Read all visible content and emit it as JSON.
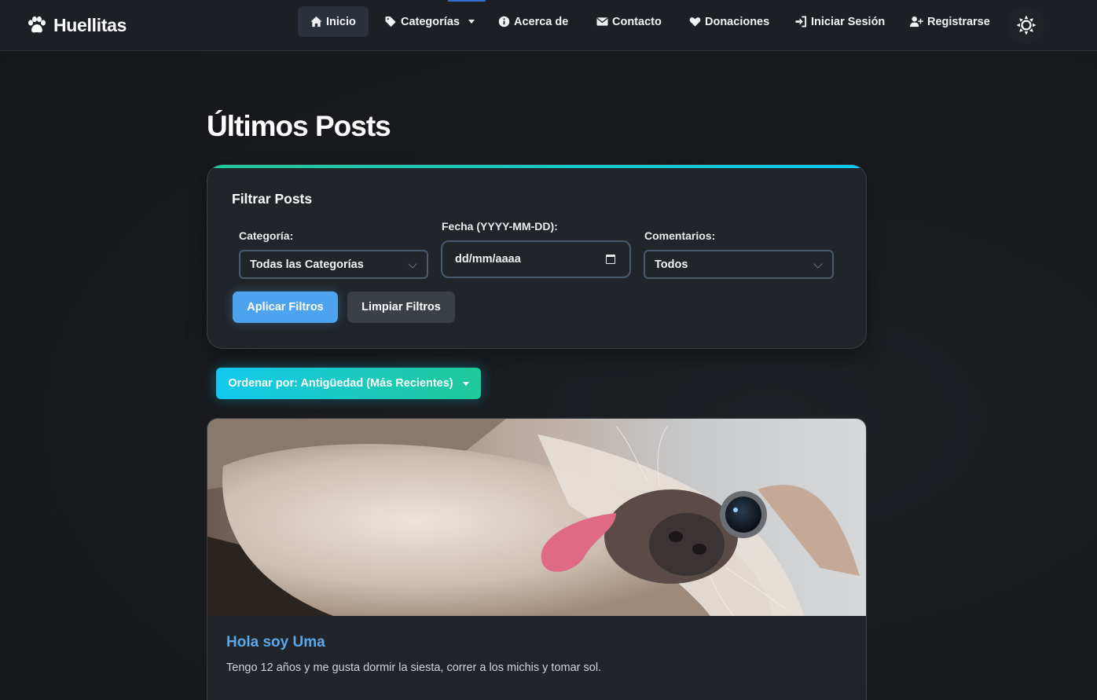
{
  "navbar": {
    "brand": "Huellitas",
    "items": [
      {
        "label": "Inicio",
        "icon": "home-icon"
      },
      {
        "label": "Categorías",
        "icon": "tags-icon"
      },
      {
        "label": "Acerca de",
        "icon": "info-circle-icon"
      },
      {
        "label": "Contacto",
        "icon": "envelope-icon"
      },
      {
        "label": "Donaciones",
        "icon": "heart-icon"
      },
      {
        "label": "Iniciar Sesión",
        "icon": "sign-in-icon"
      },
      {
        "label": "Registrarse",
        "icon": "user-plus-icon"
      }
    ],
    "theme_toggle_icon": "sun-icon"
  },
  "page": {
    "title": "Últimos Posts"
  },
  "filters": {
    "title": "Filtrar Posts",
    "category_label": "Categoría:",
    "category_value": "Todas las Categorías",
    "date_label": "Fecha (YYYY-MM-DD):",
    "date_placeholder": "dd/mm/aaaa",
    "comments_label": "Comentarios:",
    "comments_value": "Todos",
    "apply_label": "Aplicar Filtros",
    "clear_label": "Limpiar Filtros"
  },
  "sort": {
    "label": "Ordenar por: Antigüedad (Más Recientes)"
  },
  "posts": [
    {
      "title": "Hola soy Uma",
      "excerpt": "Tengo 12 años y me gusta dormir la siesta, correr a los michis y tomar sol."
    }
  ],
  "colors": {
    "accent": "#4da3ee",
    "gradient_start": "#13c9ee",
    "gradient_end": "#20c997",
    "post_title": "#5aa7ea"
  }
}
